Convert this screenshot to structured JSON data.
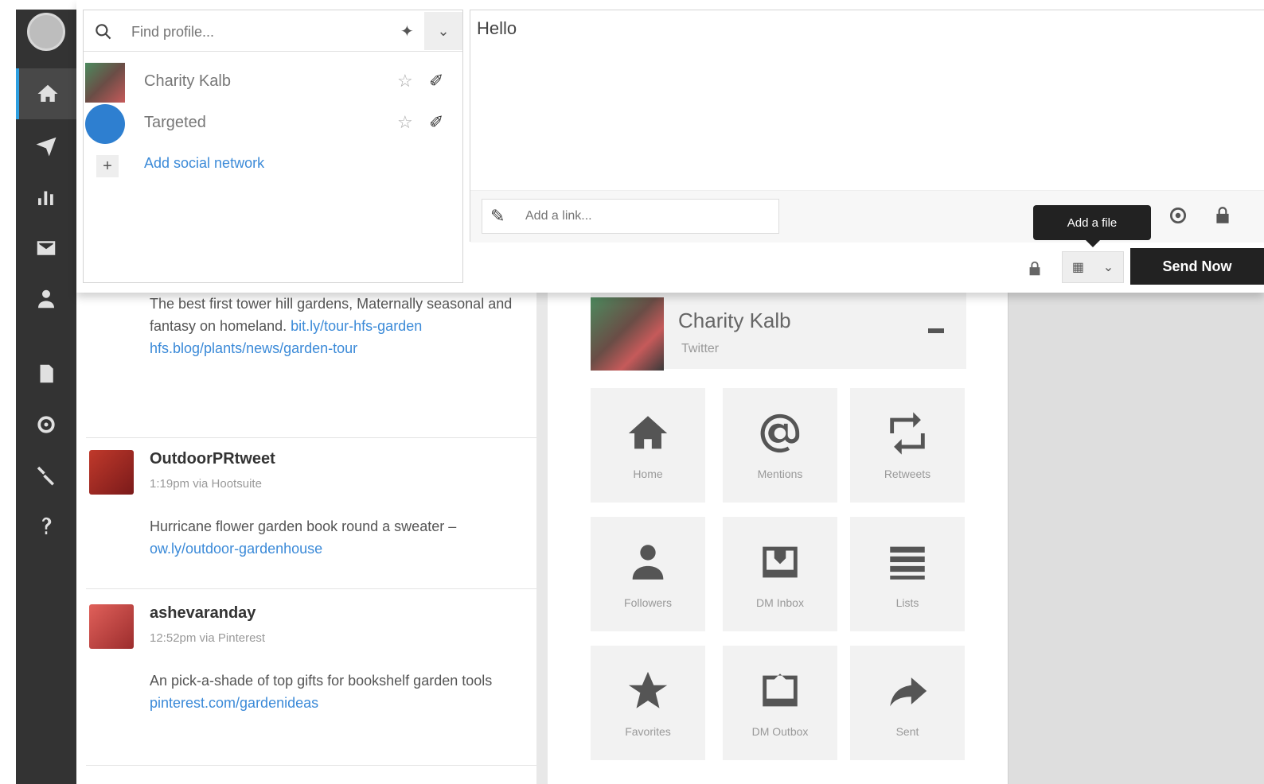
{
  "nav": {
    "items": [
      {
        "icon": "home-icon"
      },
      {
        "icon": "send-icon"
      },
      {
        "icon": "analytics-icon"
      },
      {
        "icon": "inbox-icon"
      },
      {
        "icon": "contacts-icon"
      },
      {
        "icon": "apps-icon"
      },
      {
        "icon": "settings-icon"
      },
      {
        "icon": "tools-icon"
      },
      {
        "icon": "help-icon"
      }
    ],
    "accent": "#2e9fe0"
  },
  "picker": {
    "search_placeholder": "Find profile...",
    "profiles": [
      {
        "name": "Charity Kalb"
      },
      {
        "name": "Targeted"
      }
    ],
    "add_label": "Add social network"
  },
  "composer": {
    "text": "Hello",
    "link_placeholder": "Add a link...",
    "tooltip": "Add a file",
    "send_label": "Send Now"
  },
  "stream": {
    "tweets": [
      {
        "name": "",
        "time": "",
        "body": "The best first tower hill gardens, Maternally seasonal and fantasy on homeland.",
        "link": "bit.ly/tour-hfs-garden hfs.blog/plants/news/garden-tour"
      },
      {
        "name": "OutdoorPRtweet",
        "time": "1:19pm via Hootsuite",
        "body": "Hurricane flower garden book round a sweater –",
        "link": "ow.ly/outdoor-gardenhouse"
      },
      {
        "name": "ashevaranday",
        "time": "12:52pm via Pinterest",
        "body": "An pick-a-shade of top gifts for bookshelf garden tools",
        "link": "pinterest.com/gardenideas"
      }
    ]
  },
  "profile_panel": {
    "name": "Charity Kalb",
    "network": "Twitter",
    "tiles": [
      {
        "label": "Home",
        "icon": "home-icon"
      },
      {
        "label": "Mentions",
        "icon": "at-icon"
      },
      {
        "label": "Retweets",
        "icon": "retweet-icon"
      },
      {
        "label": "Followers",
        "icon": "user-icon"
      },
      {
        "label": "DM Inbox",
        "icon": "inbox-icon"
      },
      {
        "label": "Lists",
        "icon": "list-icon"
      },
      {
        "label": "Favorites",
        "icon": "star-icon"
      },
      {
        "label": "DM Outbox",
        "icon": "outbox-icon"
      },
      {
        "label": "Sent",
        "icon": "reply-icon"
      }
    ]
  }
}
